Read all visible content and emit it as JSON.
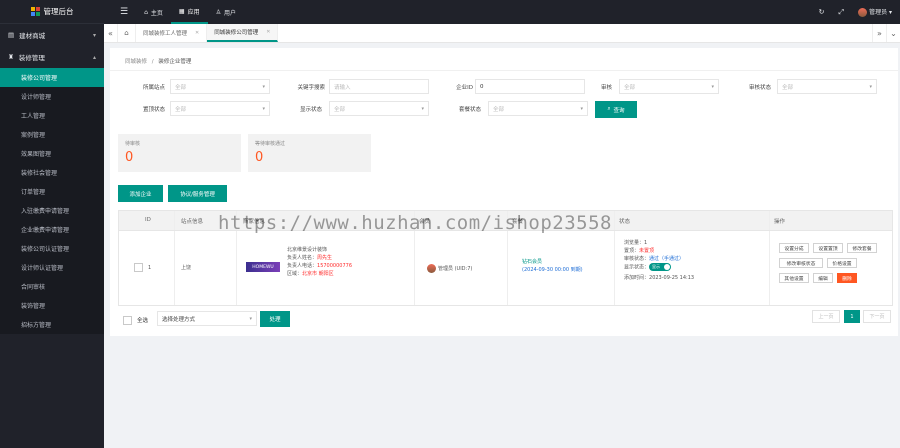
{
  "app": {
    "title": "管理后台",
    "logo_colors": [
      "#f4b400",
      "#db4437",
      "#4285f4",
      "#0f9d58"
    ]
  },
  "sidebar": {
    "groups": [
      {
        "label": "建材商城",
        "icon": "document-icon"
      },
      {
        "label": "装修管理",
        "icon": "users-icon"
      }
    ],
    "items": [
      "装修公司管理",
      "设计师管理",
      "工人管理",
      "案例管理",
      "效果图管理",
      "装修社会管理",
      "订单管理",
      "入驻缴费申请管理",
      "企业缴费申请管理",
      "装修公司认证管理",
      "设计师认证管理",
      "合同审核",
      "装饰管理",
      "招标方管理"
    ],
    "active_index": 0
  },
  "topbar": {
    "nav": [
      {
        "label": "主页",
        "icon": "home-icon"
      },
      {
        "label": "应用",
        "icon": "app-icon"
      },
      {
        "label": "用户",
        "icon": "user-icon"
      }
    ],
    "active_index": 1,
    "admin": "管理员"
  },
  "tabs": {
    "items": [
      "同城装修工人管理",
      "同城装修公司管理"
    ],
    "active_index": 1
  },
  "breadcrumb": {
    "parent": "同城装修",
    "sep": "/",
    "current": "装修企业管理"
  },
  "filters": {
    "station": {
      "label": "所属站点",
      "placeholder": "全部"
    },
    "keyword": {
      "label": "关键字搜索",
      "placeholder": "请输入"
    },
    "company_id": {
      "label": "企业ID",
      "value": "0"
    },
    "audit": {
      "label": "审核",
      "placeholder": "全部"
    },
    "audit_status": {
      "label": "审核状态",
      "placeholder": "全部"
    },
    "top_status": {
      "label": "置顶状态",
      "placeholder": "全部"
    },
    "show_status": {
      "label": "显示状态",
      "placeholder": "全部"
    },
    "pkg_status": {
      "label": "套餐状态",
      "placeholder": "全部"
    },
    "query_btn": "查询"
  },
  "stats": [
    {
      "title": "待审核",
      "value": "0"
    },
    {
      "title": "等待审核通过",
      "value": "0"
    }
  ],
  "actions": {
    "add": "添加企业",
    "agreement": "协议/服务管理"
  },
  "table": {
    "headers": [
      "ID",
      "站点信息",
      "商家信息",
      "会员",
      "套餐",
      "状态",
      "操作"
    ],
    "row": {
      "id": "1",
      "station": "上饶",
      "brand_text": "HOMEWU",
      "company": "北京维景设计装饰",
      "contact_label": "负责人姓名：",
      "contact_name": "周先生",
      "phone_label": "负责人电话：",
      "phone": "15700000776",
      "area_label": "区域：",
      "area": "北京市 朝阳区",
      "member": "管理员 (UID:7)",
      "pkg_name": "钻石会员",
      "pkg_date": "(2024-09-30 00:00 到期)",
      "status_lines": [
        {
          "label": "浏览量：",
          "value": "1"
        },
        {
          "label": "置顶：",
          "value": "未置顶"
        },
        {
          "label": "审核状态：",
          "value": "通过（手通过）"
        },
        {
          "label": "显示状态：",
          "value": "显示"
        },
        {
          "label": "添加时间：",
          "value": "2023-09-25 14:13"
        }
      ],
      "ops": [
        "设置分成",
        "设置置顶",
        "修改套餐",
        "修改审核状态",
        "价格设置",
        "其他设置",
        "编辑",
        "删除"
      ]
    }
  },
  "footer": {
    "select_all": "全选",
    "batch_placeholder": "选择处理方式",
    "batch_btn": "处理",
    "pager": {
      "prev": "上一页",
      "page": "1",
      "next": "下一页"
    }
  },
  "watermark": "https://www.huzhan.com/ishop23558",
  "colors": {
    "accent": "#009688",
    "sidebar": "#20222a",
    "danger": "#ff5722"
  }
}
